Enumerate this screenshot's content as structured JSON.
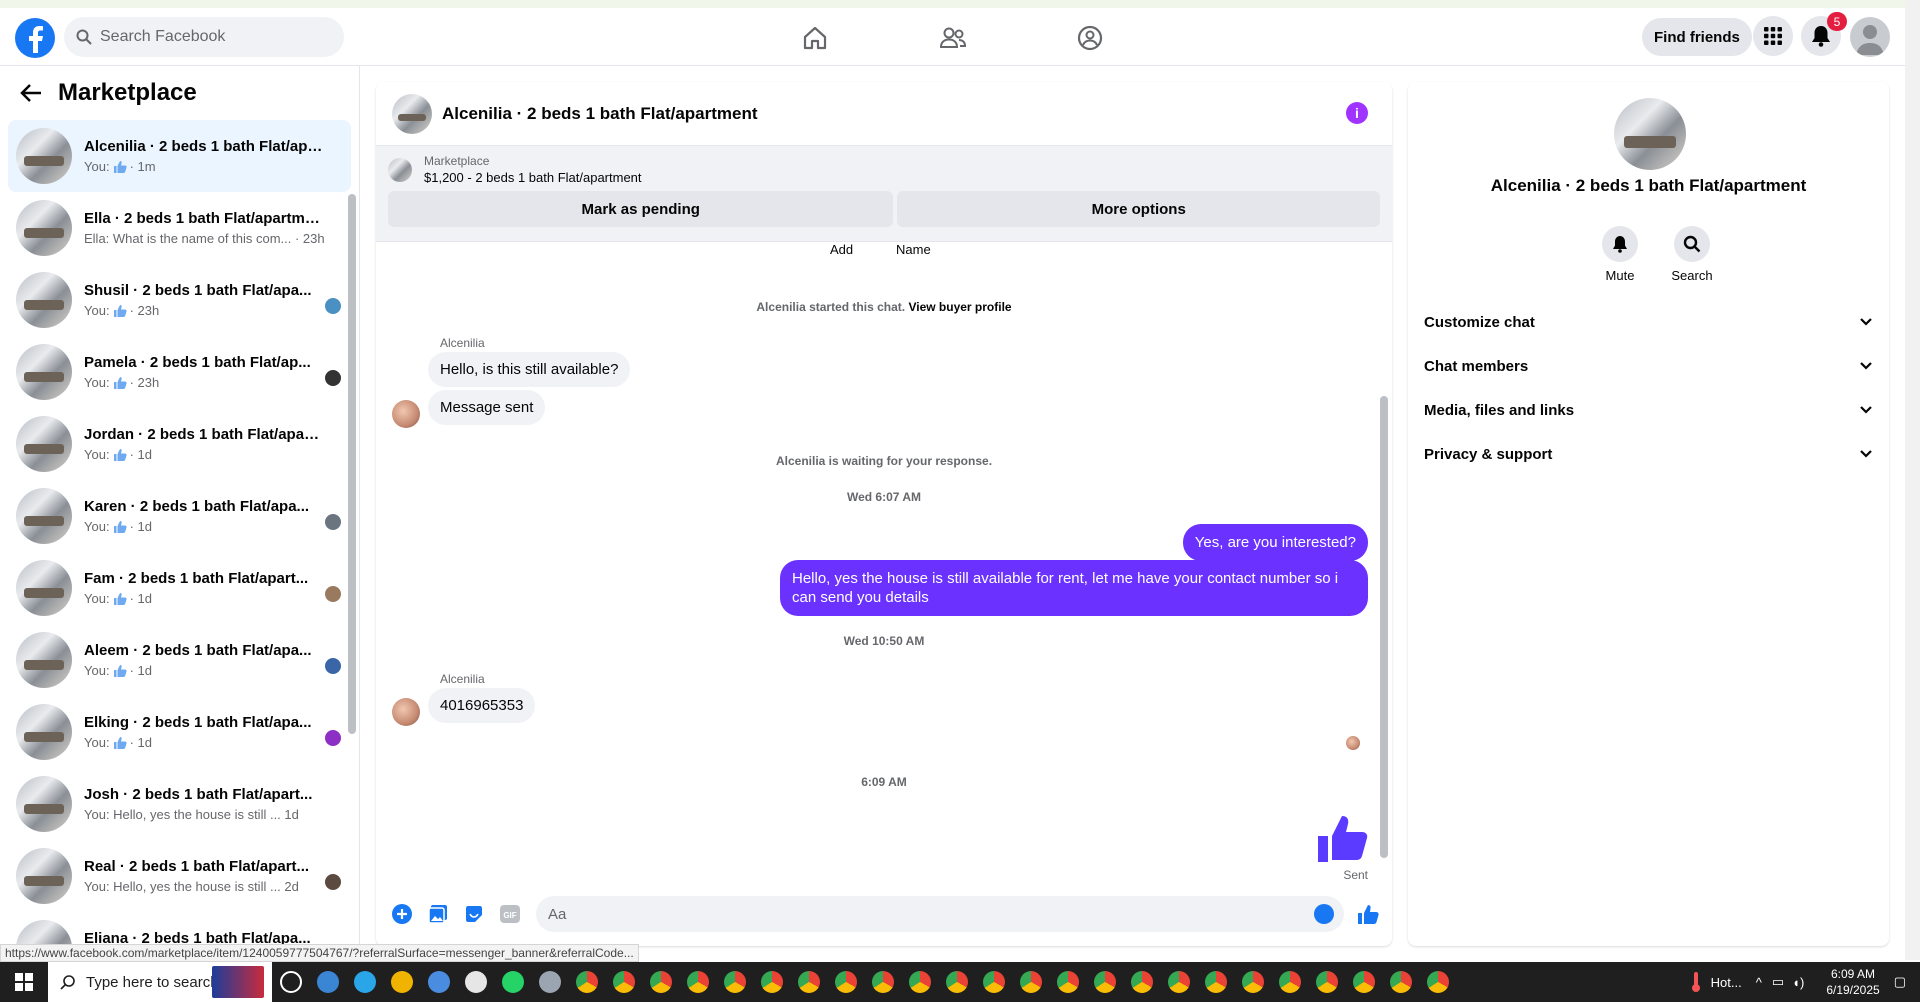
{
  "header": {
    "search_placeholder": "Search Facebook",
    "find_friends_label": "Find friends",
    "notifications_count": "5"
  },
  "sidebar": {
    "title": "Marketplace",
    "conversations": [
      {
        "title": "Alcenilia · 2 beds 1 bath Flat/apa...",
        "sub_prefix": "You:",
        "sub_time": "· 1m",
        "liked": true
      },
      {
        "title": "Ella · 2 beds 1 bath Flat/apartment",
        "sub_prefix": "Ella: What is the name of this com...",
        "sub_time": "· 23h",
        "liked": false
      },
      {
        "title": "Shusil · 2 beds 1 bath Flat/apa...",
        "sub_prefix": "You:",
        "sub_time": "· 23h",
        "liked": true
      },
      {
        "title": "Pamela · 2 beds 1 bath Flat/ap...",
        "sub_prefix": "You:",
        "sub_time": "· 23h",
        "liked": true
      },
      {
        "title": "Jordan · 2 beds 1 bath Flat/apart...",
        "sub_prefix": "You:",
        "sub_time": "· 1d",
        "liked": true
      },
      {
        "title": "Karen · 2 beds 1 bath Flat/apa...",
        "sub_prefix": "You:",
        "sub_time": "· 1d",
        "liked": true
      },
      {
        "title": "Fam · 2 beds 1 bath Flat/apart...",
        "sub_prefix": "You:",
        "sub_time": "· 1d",
        "liked": true
      },
      {
        "title": "Aleem · 2 beds 1 bath Flat/apa...",
        "sub_prefix": "You:",
        "sub_time": "· 1d",
        "liked": true
      },
      {
        "title": "Elking · 2 beds 1 bath Flat/apa...",
        "sub_prefix": "You:",
        "sub_time": "· 1d",
        "liked": true
      },
      {
        "title": "Josh · 2 beds 1 bath Flat/apart...",
        "sub_prefix": "You: Hello, yes the house is still ...",
        "sub_time": "1d",
        "liked": false
      },
      {
        "title": "Real · 2 beds 1 bath Flat/apart...",
        "sub_prefix": "You: Hello, yes the house is still ...",
        "sub_time": "2d",
        "liked": false
      },
      {
        "title": "Eliana · 2 beds 1 bath Flat/apa...",
        "sub_prefix": "",
        "sub_time": "",
        "liked": false
      }
    ]
  },
  "chat": {
    "title": "Alcenilia · 2 beds 1 bath Flat/apartment",
    "marketplace_label": "Marketplace",
    "listing": "$1,200 - 2 beds 1 bath Flat/apartment",
    "mark_pending": "Mark as pending",
    "more_options": "More options",
    "cut_add": "Add",
    "cut_name": "Name",
    "started_text": "Alcenilia started this chat.",
    "view_buyer": "View buyer profile",
    "sender_name": "Alcenilia",
    "msg_1": "Hello, is this still available?",
    "msg_2": "Message sent",
    "waiting": "Alcenilia is waiting for your response.",
    "time_1": "Wed 6:07 AM",
    "out_1": "Yes, are you interested?",
    "out_2": "Hello, yes the house is still available for rent, let me have your contact number so i can send you details",
    "time_2": "Wed 10:50 AM",
    "sender_name_2": "Alcenilia",
    "msg_3": "4016965353",
    "time_3": "6:09 AM",
    "sent_label": "Sent",
    "composer_placeholder": "Aa"
  },
  "info_panel": {
    "title": "Alcenilia · 2 beds 1 bath Flat/apartment",
    "mute": "Mute",
    "search": "Search",
    "sections": [
      "Customize chat",
      "Chat members",
      "Media, files and links",
      "Privacy & support"
    ]
  },
  "status_url": "https://www.facebook.com/marketplace/item/1240059777504767/?referralSurface=messenger_banner&referralCode...",
  "taskbar": {
    "search_placeholder": "Type here to search",
    "weather": "Hot...",
    "time": "6:09 AM",
    "date": "6/19/2025"
  },
  "colors": {
    "brand": "#1877f2",
    "bubble_out": "#6b31ff",
    "badge": "#e41e3f"
  }
}
